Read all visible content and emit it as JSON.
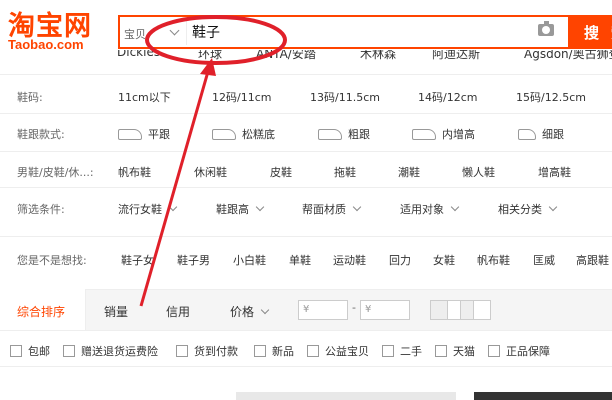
{
  "logo": {
    "cn": "淘宝网",
    "en": "Taobao.com"
  },
  "search": {
    "type_label": "宝贝",
    "query": "鞋子",
    "button_label": "搜索"
  },
  "brands": [
    "Dickies",
    "环球",
    "ANTA/安踏",
    "木林森",
    "阿迪达斯",
    "Agsdon/奥古狮登"
  ],
  "filters": {
    "size": {
      "label": "鞋码:",
      "options": [
        "11cm以下",
        "12码/11cm",
        "13码/11.5cm",
        "14码/12cm",
        "15码/12.5cm"
      ]
    },
    "heel": {
      "label": "鞋跟款式:",
      "options": [
        "平跟",
        "松糕底",
        "粗跟",
        "内增高",
        "细跟"
      ]
    },
    "type": {
      "label": "男鞋/皮鞋/休...:",
      "options": [
        "帆布鞋",
        "休闲鞋",
        "皮鞋",
        "拖鞋",
        "潮鞋",
        "懒人鞋",
        "增高鞋"
      ]
    },
    "more": {
      "label": "筛选条件:",
      "options": [
        "流行女鞋",
        "鞋跟高",
        "帮面材质",
        "适用对象",
        "相关分类"
      ]
    }
  },
  "suggest": {
    "label": "您是不是想找:",
    "items": [
      "鞋子女",
      "鞋子男",
      "小白鞋",
      "单鞋",
      "运动鞋",
      "回力",
      "女鞋",
      "帆布鞋",
      "匡威",
      "高跟鞋"
    ]
  },
  "sort": {
    "items": [
      "综合排序",
      "销量",
      "信用",
      "价格"
    ],
    "price_min_placeholder": "¥",
    "price_max_placeholder": "¥",
    "dash": "-"
  },
  "checks": [
    "包邮",
    "赠送退货运费险",
    "货到付款",
    "新品",
    "公益宝贝",
    "二手",
    "天猫",
    "正品保障"
  ],
  "colors": {
    "accent": "#ff4400",
    "annotation": "#e0202a"
  }
}
